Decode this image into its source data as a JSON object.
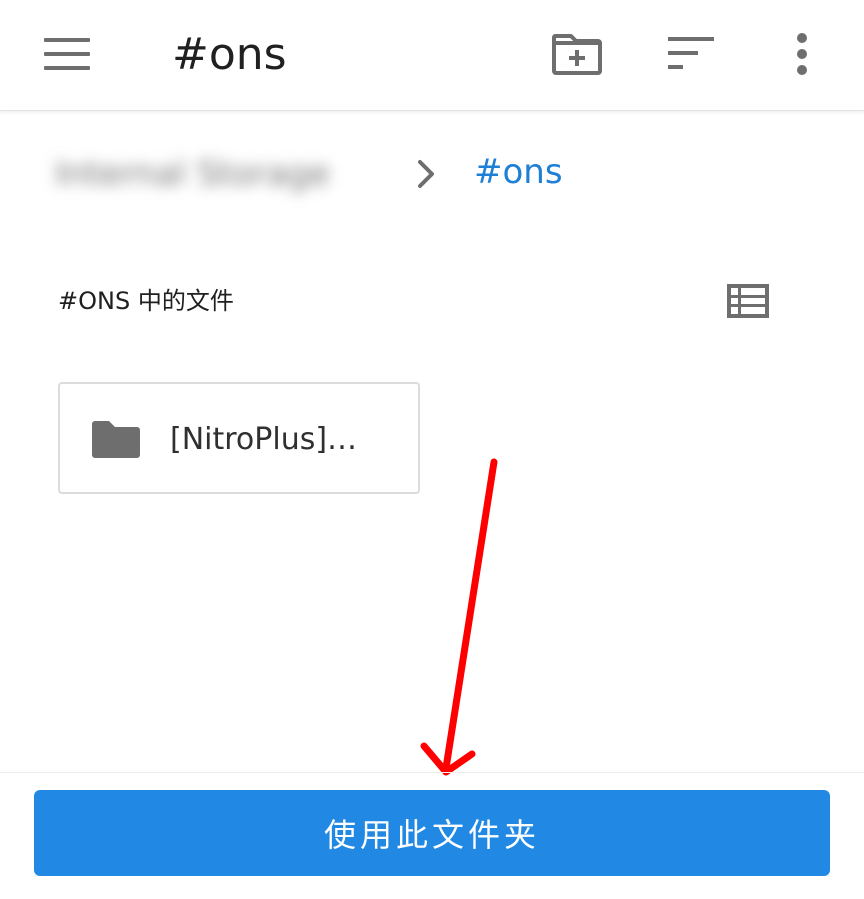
{
  "toolbar": {
    "title": "#ons",
    "icons": {
      "menu": "hamburger-menu-icon",
      "new_folder": "create-folder-icon",
      "sort": "sort-icon",
      "more": "more-vert-icon"
    }
  },
  "breadcrumb": {
    "root_label": "Internal Storage",
    "separator_icon": "chevron-right-icon",
    "current": "#ons"
  },
  "section": {
    "title": "#ONS 中的文件",
    "view_toggle_icon": "list-view-icon"
  },
  "items": [
    {
      "name": "[NitroPlus]…",
      "icon": "folder-icon"
    }
  ],
  "actions": {
    "use_folder_label": "使用此文件夹"
  },
  "colors": {
    "accent": "#2188e3",
    "breadcrumb_link": "#1e7fd6",
    "annotation_arrow": "#ff0000",
    "icon_gray": "#6e6e6e"
  }
}
